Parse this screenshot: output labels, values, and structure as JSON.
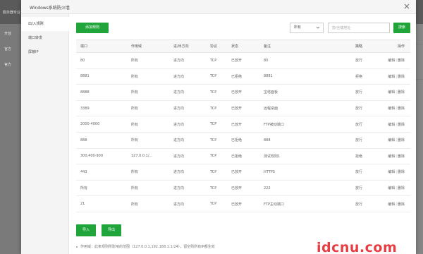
{
  "background": {
    "header_title": "服务器专业",
    "sidebar_items": [
      "开放",
      "官方",
      "官方"
    ]
  },
  "modal": {
    "title": "Windows系统防火墙",
    "close_icon": "close-icon",
    "side_menu": [
      {
        "label": "出/入规则",
        "active": true
      },
      {
        "label": "端口转发",
        "active": false
      },
      {
        "label": "屏蔽IP",
        "active": false
      }
    ]
  },
  "toolbar": {
    "add_label": "添加规则",
    "filter_value": "所有",
    "search_placeholder": "协/全端地址",
    "search_value": "",
    "search_button": "搜索"
  },
  "table": {
    "columns": [
      "端口",
      "作用域",
      "进/出方向",
      "协议",
      "状态",
      "备注",
      "策略",
      "操作"
    ],
    "rows": [
      {
        "port": "80",
        "scope": "所有",
        "dir": "进方向",
        "proto": "TCP",
        "status": "已放开",
        "status_ok": true,
        "note": "80",
        "action": "放行",
        "action_ok": true,
        "edit": "编辑",
        "del": "删除"
      },
      {
        "port": "8881",
        "scope": "所有",
        "dir": "进方向",
        "proto": "TCP",
        "status": "已拒绝",
        "status_ok": false,
        "note": "8881",
        "action": "拒绝",
        "action_ok": false,
        "edit": "编辑",
        "del": "删除"
      },
      {
        "port": "8888",
        "scope": "所有",
        "dir": "进方向",
        "proto": "TCP",
        "status": "已放开",
        "status_ok": true,
        "note": "宝塔面板",
        "action": "放行",
        "action_ok": true,
        "edit": "编辑",
        "del": "删除"
      },
      {
        "port": "3389",
        "scope": "所有",
        "dir": "进方向",
        "proto": "TCP",
        "status": "已放开",
        "status_ok": true,
        "note": "远程桌面",
        "action": "放行",
        "action_ok": true,
        "edit": "编辑",
        "del": "删除"
      },
      {
        "port": "2000-4000",
        "scope": "所有",
        "dir": "进方向",
        "proto": "TCP",
        "status": "已放开",
        "status_ok": true,
        "note": "FTP被动端口",
        "action": "放行",
        "action_ok": true,
        "edit": "编辑",
        "del": "删除"
      },
      {
        "port": "888",
        "scope": "所有",
        "dir": "进方向",
        "proto": "TCP",
        "status": "已拒绝",
        "status_ok": false,
        "note": "888",
        "action": "放行",
        "action_ok": true,
        "edit": "编辑",
        "del": "删除"
      },
      {
        "port": "300,400-900",
        "scope": "127.0.0.1/...",
        "dir": "进方向",
        "proto": "TCP",
        "status": "已拒绝",
        "status_ok": false,
        "note": "测试规则1",
        "action": "拒绝",
        "action_ok": false,
        "edit": "编辑",
        "del": "删除"
      },
      {
        "port": "443",
        "scope": "所有",
        "dir": "进方向",
        "proto": "TCP",
        "status": "已放开",
        "status_ok": true,
        "note": "HTTPS",
        "action": "放行",
        "action_ok": true,
        "edit": "编辑",
        "del": "删除"
      },
      {
        "port": "所有",
        "scope": "所有",
        "dir": "进方向",
        "proto": "TCP",
        "status": "已放开",
        "status_ok": true,
        "note": "222",
        "action": "放行",
        "action_ok": true,
        "edit": "编辑",
        "del": "删除"
      },
      {
        "port": "21",
        "scope": "所有",
        "dir": "进方向",
        "proto": "TCP",
        "status": "已放开",
        "status_ok": true,
        "note": "FTP主动端口",
        "action": "放行",
        "action_ok": true,
        "edit": "编辑",
        "del": "删除"
      }
    ]
  },
  "footer": {
    "import_label": "导入",
    "export_label": "导出",
    "note": "作用域：此条规则所影响的范围（127.0.0.1,192.168.1.1/24），留空则所有IP都生效"
  },
  "watermark": "idcnu.com",
  "colors": {
    "accent": "#20a53a",
    "danger": "#ef0808"
  }
}
